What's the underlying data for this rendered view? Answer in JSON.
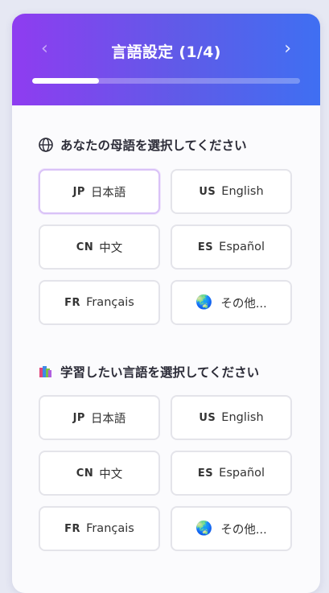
{
  "header": {
    "title": "言語設定 (1/4)",
    "prev_icon": "‹",
    "next_icon": "›",
    "progress_fraction": 0.25
  },
  "native_section": {
    "title": "あなたの母語を選択してください",
    "icon": "globe-outline-icon",
    "options": [
      {
        "code": "JP",
        "label": "日本語",
        "selected": true
      },
      {
        "code": "US",
        "label": "English",
        "selected": false
      },
      {
        "code": "CN",
        "label": "中文",
        "selected": false
      },
      {
        "code": "ES",
        "label": "Español",
        "selected": false
      },
      {
        "code": "FR",
        "label": "Français",
        "selected": false
      },
      {
        "code": "🌏",
        "label": "その他...",
        "selected": false
      }
    ]
  },
  "learning_section": {
    "title": "学習したい言語を選択してください",
    "icon": "books-icon",
    "options": [
      {
        "code": "JP",
        "label": "日本語",
        "selected": false
      },
      {
        "code": "US",
        "label": "English",
        "selected": false
      },
      {
        "code": "CN",
        "label": "中文",
        "selected": false
      },
      {
        "code": "ES",
        "label": "Español",
        "selected": false
      },
      {
        "code": "FR",
        "label": "Français",
        "selected": false
      },
      {
        "code": "🌏",
        "label": "その他...",
        "selected": false
      }
    ]
  },
  "colors": {
    "gradient_start": "#8f3cf0",
    "gradient_end": "#3f6ff2",
    "selected_border": "#d9c2f7"
  }
}
